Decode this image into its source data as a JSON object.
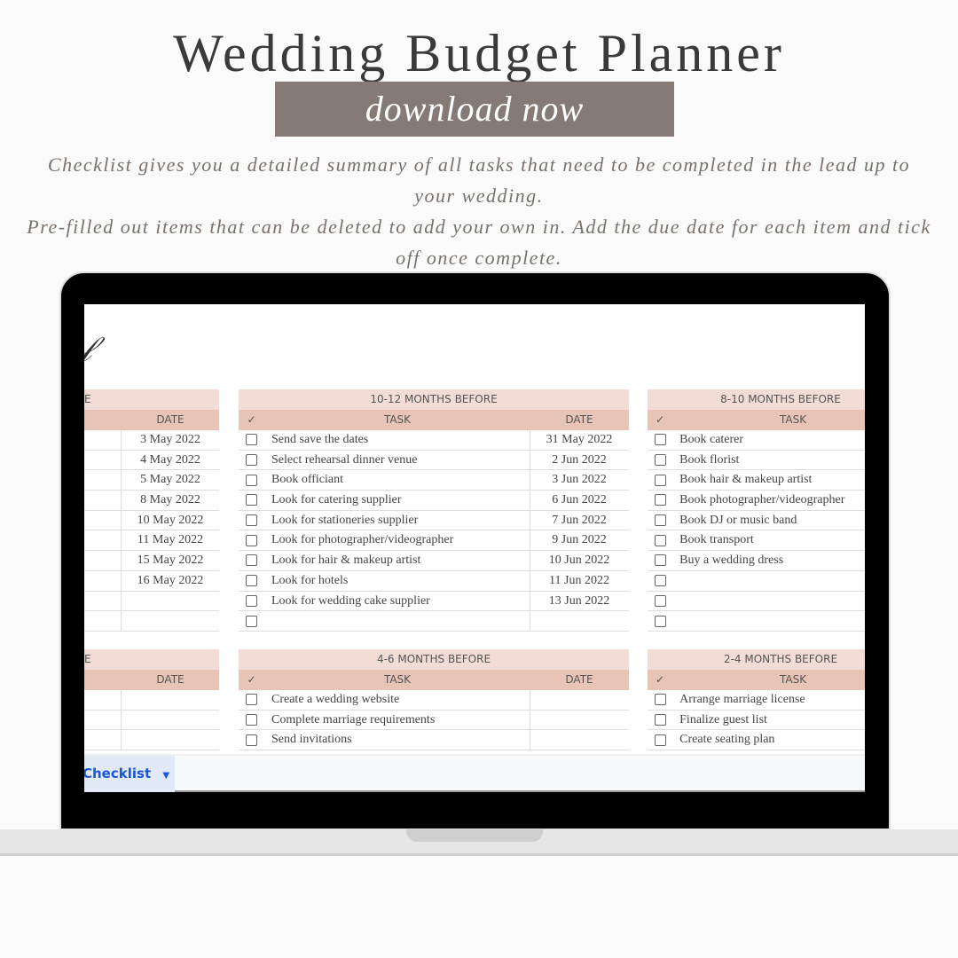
{
  "header": {
    "title": "Wedding Budget Planner",
    "cta": "download now",
    "desc1": "Checklist gives you a detailed summary of all tasks that need to be completed in the lead up to your wedding.",
    "desc2": "Pre-filled out items that can be deleted to add your own in. Add the due date for each item and tick off once complete."
  },
  "sheet": {
    "tab": "Checklist",
    "columns": {
      "check": "✓",
      "task": "TASK",
      "date": "DATE"
    },
    "tables": [
      {
        "title": "E",
        "rows": [
          [
            "",
            "3 May 2022"
          ],
          [
            "",
            "4 May 2022"
          ],
          [
            "",
            "5 May 2022"
          ],
          [
            "",
            "8 May 2022"
          ],
          [
            "",
            "10 May 2022"
          ],
          [
            "",
            "11 May 2022"
          ],
          [
            "",
            "15 May 2022"
          ],
          [
            "",
            "16 May 2022"
          ],
          [
            "",
            ""
          ],
          [
            "",
            ""
          ]
        ]
      },
      {
        "title": "10-12 MONTHS BEFORE",
        "rows": [
          [
            "Send save the dates",
            "31 May 2022"
          ],
          [
            "Select rehearsal dinner venue",
            "2 Jun 2022"
          ],
          [
            "Book officiant",
            "3 Jun 2022"
          ],
          [
            "Look for catering supplier",
            "6 Jun 2022"
          ],
          [
            "Look for stationeries supplier",
            "7 Jun 2022"
          ],
          [
            "Look for photographer/videographer",
            "9 Jun 2022"
          ],
          [
            "Look for hair & makeup artist",
            "10 Jun 2022"
          ],
          [
            "Look for hotels",
            "11 Jun 2022"
          ],
          [
            "Look for wedding cake supplier",
            "13 Jun 2022"
          ],
          [
            "",
            ""
          ]
        ]
      },
      {
        "title": "8-10 MONTHS BEFORE",
        "rows": [
          [
            "Book caterer",
            ""
          ],
          [
            "Book florist",
            ""
          ],
          [
            "Book hair & makeup artist",
            ""
          ],
          [
            "Book photographer/videographer",
            ""
          ],
          [
            "Book DJ or music band",
            ""
          ],
          [
            "Book transport",
            ""
          ],
          [
            "Buy a wedding dress",
            ""
          ],
          [
            "",
            ""
          ],
          [
            "",
            ""
          ],
          [
            "",
            ""
          ]
        ]
      },
      {
        "title": "E",
        "rows": [
          [
            "",
            ""
          ],
          [
            "",
            ""
          ],
          [
            "",
            ""
          ]
        ]
      },
      {
        "title": "4-6 MONTHS BEFORE",
        "rows": [
          [
            "Create a wedding website",
            ""
          ],
          [
            "Complete marriage requirements",
            ""
          ],
          [
            "Send invitations",
            ""
          ]
        ]
      },
      {
        "title": "2-4 MONTHS BEFORE",
        "rows": [
          [
            "Arrange marriage license",
            ""
          ],
          [
            "Finalize guest list",
            ""
          ],
          [
            "Create seating plan",
            ""
          ]
        ]
      }
    ]
  }
}
